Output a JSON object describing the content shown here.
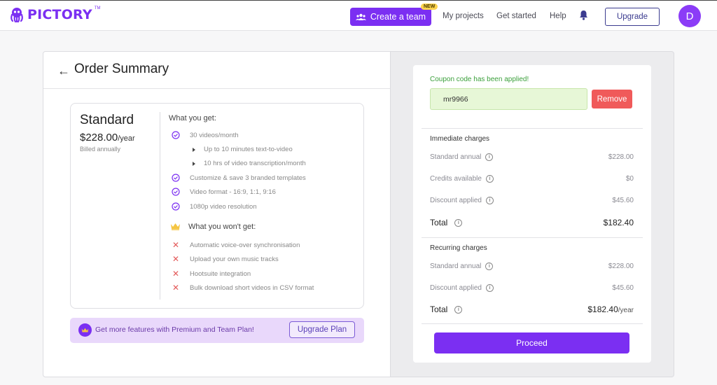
{
  "header": {
    "logo_text": "PICTORY",
    "logo_tm": "TM",
    "create_team_label": "Create a team",
    "new_badge": "NEW",
    "nav": [
      "My projects",
      "Get started",
      "Help"
    ],
    "upgrade_label": "Upgrade",
    "avatar_initial": "D"
  },
  "order": {
    "title": "Order Summary",
    "plan": {
      "name": "Standard",
      "price": "$228.00",
      "period": "/year",
      "billing": "Billed annually"
    },
    "get_heading": "What you get:",
    "get_items": {
      "a": "30 videos/month",
      "a1": "Up to 10 minutes text-to-video",
      "a2": "10 hrs of video transcription/month",
      "b": "Customize & save 3 branded templates",
      "c": "Video format - 16:9, 1:1, 9:16",
      "d": "1080p video resolution"
    },
    "not_heading": "What you won't get:",
    "not_items": [
      "Automatic voice-over synchronisation",
      "Upload your own music tracks",
      "Hootsuite integration",
      "Bulk download short videos in CSV format"
    ],
    "promo_text": "Get more features with Premium and Team Plan!",
    "promo_button": "Upgrade Plan"
  },
  "summary": {
    "coupon_message": "Coupon code has been applied!",
    "coupon_code": "mr9966",
    "remove_label": "Remove",
    "immediate": {
      "title": "Immediate charges",
      "standard_label": "Standard annual",
      "standard_value": "$228.00",
      "credits_label": "Credits available",
      "credits_value": "$0",
      "discount_label": "Discount applied",
      "discount_value": "$45.60",
      "total_label": "Total",
      "total_value": "$182.40"
    },
    "recurring": {
      "title": "Recurring charges",
      "standard_label": "Standard annual",
      "standard_value": "$228.00",
      "discount_label": "Discount applied",
      "discount_value": "$45.60",
      "total_label": "Total",
      "total_value": "$182.40",
      "total_period": "/year"
    },
    "proceed_label": "Proceed"
  },
  "colors": {
    "brand": "#7b2ff2",
    "success": "#3ca03c",
    "danger": "#f05a5a"
  }
}
